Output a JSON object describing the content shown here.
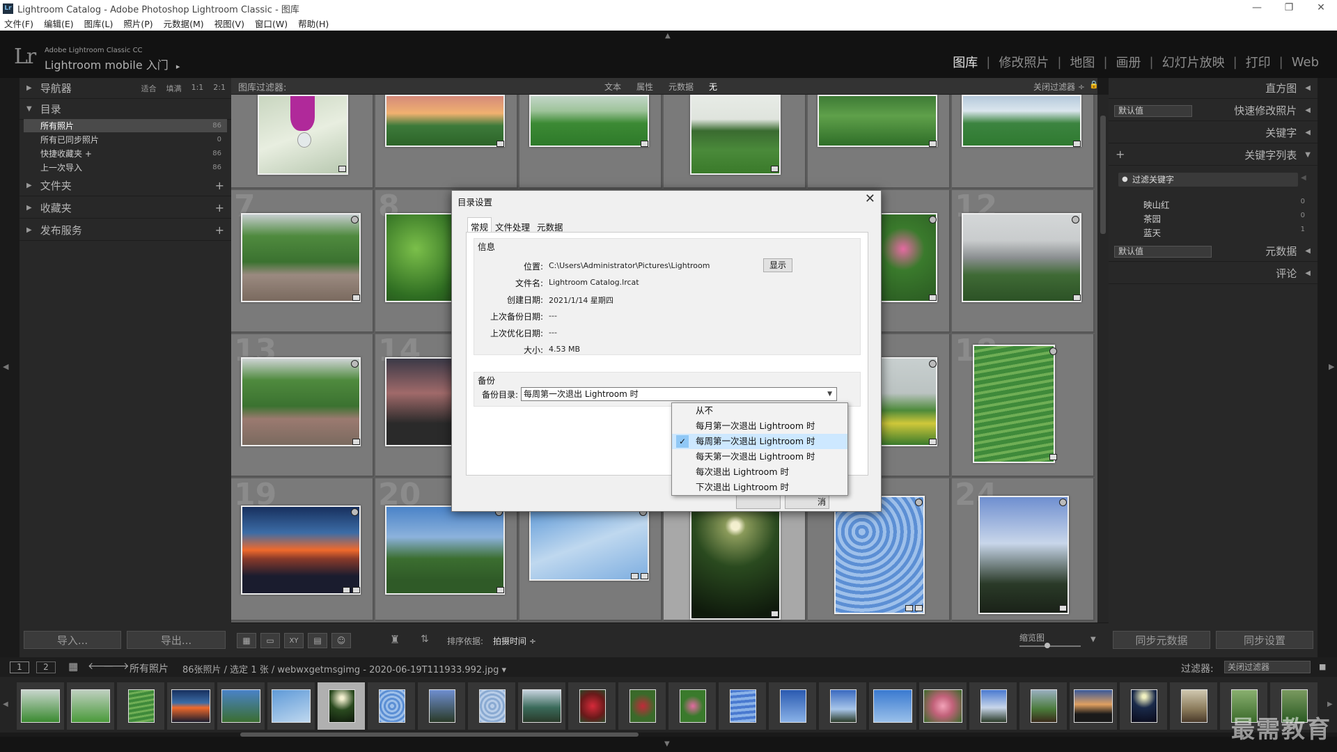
{
  "window": {
    "title": "Lightroom Catalog - Adobe Photoshop Lightroom Classic - 图库",
    "app_icon": "Lr",
    "controls": [
      "—",
      "❐",
      "✕"
    ]
  },
  "menu": [
    "文件(F)",
    "编辑(E)",
    "图库(L)",
    "照片(P)",
    "元数据(M)",
    "视图(V)",
    "窗口(W)",
    "帮助(H)"
  ],
  "identity": {
    "logo": "Lr",
    "app_name": "Adobe Lightroom Classic CC",
    "mobile": "Lightroom mobile 入门",
    "arrow": "▸"
  },
  "modules": {
    "items": [
      "图库",
      "修改照片",
      "地图",
      "画册",
      "幻灯片放映",
      "打印",
      "Web"
    ],
    "active": "图库",
    "separator": "|"
  },
  "left_panel": {
    "navigator": {
      "label": "导航器",
      "options": [
        "适合",
        "填满",
        "1:1",
        "2:1"
      ]
    },
    "catalog": {
      "label": "目录",
      "items": [
        {
          "label": "所有照片",
          "count": "86"
        },
        {
          "label": "所有已同步照片",
          "count": "0"
        },
        {
          "label": "快捷收藏夹 +",
          "count": "86"
        },
        {
          "label": "上一次导入",
          "count": "86"
        }
      ]
    },
    "folders": "文件夹",
    "collections": "收藏夹",
    "publish": "发布服务",
    "import_btn": "导入...",
    "export_btn": "导出..."
  },
  "filter_bar": {
    "label": "图库过滤器:",
    "options": [
      "文本",
      "属性",
      "元数据",
      "无"
    ],
    "active": "无",
    "close_filter": "关闭过滤器 ÷"
  },
  "grid": {
    "row_numbers": [
      "7",
      "8",
      "12",
      "13",
      "14",
      "18",
      "19",
      "20",
      "24"
    ]
  },
  "toolbar": {
    "sort_label": "排序依据:",
    "sort_value": "拍摄时间 ÷",
    "thumbnail_label": "缩览图"
  },
  "right_panel": {
    "histogram": "直方图",
    "default_value": "默认值",
    "quick_develop": "快速修改照片",
    "keywords": "关键字",
    "keyword_list": "关键字列表",
    "filter_keywords": "过滤关键字",
    "keyword_items": [
      {
        "label": "映山红",
        "count": "0"
      },
      {
        "label": "茶园",
        "count": "0"
      },
      {
        "label": "蓝天",
        "count": "1"
      }
    ],
    "metadata_default": "默认值",
    "metadata": "元数据",
    "comments": "评论",
    "sync_metadata": "同步元数据",
    "sync_settings": "同步设置"
  },
  "filmstrip_bar": {
    "view1": "1",
    "view2": "2",
    "source": "所有照片",
    "info": "86张照片 / 选定 1 张 / webwxgetmsgimg - 2020-06-19T111933.992.jpg ▾",
    "filter_label": "过滤器:",
    "filter_value": "关闭过滤器"
  },
  "dialog": {
    "title": "目录设置",
    "close": "✕",
    "tabs": [
      "常规",
      "文件处理",
      "元数据"
    ],
    "active_tab": "常规",
    "info_group": "信息",
    "fields": [
      {
        "label": "位置:",
        "value": "C:\\Users\\Administrator\\Pictures\\Lightroom"
      },
      {
        "label": "文件名:",
        "value": "Lightroom Catalog.lrcat"
      },
      {
        "label": "创建日期:",
        "value": "2021/1/14 星期四"
      },
      {
        "label": "上次备份日期:",
        "value": "---"
      },
      {
        "label": "上次优化日期:",
        "value": "---"
      },
      {
        "label": "大小:",
        "value": "4.53 MB"
      }
    ],
    "show_button": "显示",
    "backup_group": "备份",
    "backup_label": "备份目录:",
    "backup_value": "每周第一次退出 Lightroom 时",
    "partial_button": "消",
    "options": [
      "从不",
      "每月第一次退出 Lightroom 时",
      "每周第一次退出 Lightroom 时",
      "每天第一次退出 Lightroom 时",
      "每次退出 Lightroom 时",
      "下次退出 Lightroom 时"
    ],
    "selected_option_index": 2
  },
  "watermark": "最需教育",
  "colors": {
    "grid_bg": "#5e5e5e",
    "panel_bg": "#282828",
    "accent_selected": "#cde8ff"
  }
}
